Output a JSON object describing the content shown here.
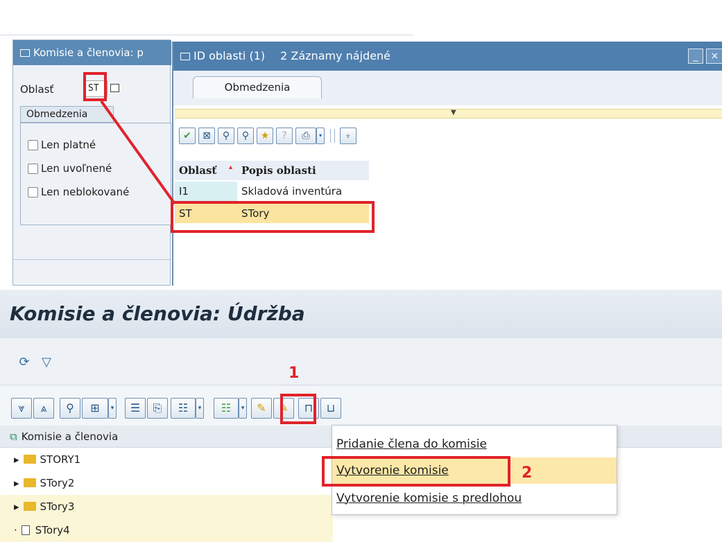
{
  "top": {
    "left_dialog": {
      "title": "Komisie a členovia: p",
      "field_label": "Oblasť",
      "field_value": "ST",
      "tab": "Obmedzenia",
      "checkboxes": [
        "Len platné",
        "Len uvoľnené",
        "Len neblokované"
      ]
    },
    "search_dialog": {
      "title": "ID oblasti (1)",
      "found": "2 Záznamy nájdené",
      "tab": "Obmedzenia",
      "columns": [
        "Oblasť",
        "Popis oblasti"
      ],
      "rows": [
        {
          "code": "I1",
          "description": "Skladová inventúra"
        },
        {
          "code": "ST",
          "description": "STory"
        }
      ]
    }
  },
  "bottom": {
    "page_title": "Komisie a členovia: Údržba",
    "tree_header": "Komisie a členovia",
    "tree_items": [
      "STORY1",
      "STory2",
      "STory3",
      "STory4"
    ],
    "step1": "1",
    "step2": "2",
    "menu": [
      "Pridanie člena do komisie",
      "Vytvorenie komisie",
      "Vytvorenie komisie s predlohou"
    ]
  },
  "colors": {
    "highlight_red": "#e0232b",
    "title_blue": "#4f7fae",
    "selected_row": "#fbe4a0"
  }
}
